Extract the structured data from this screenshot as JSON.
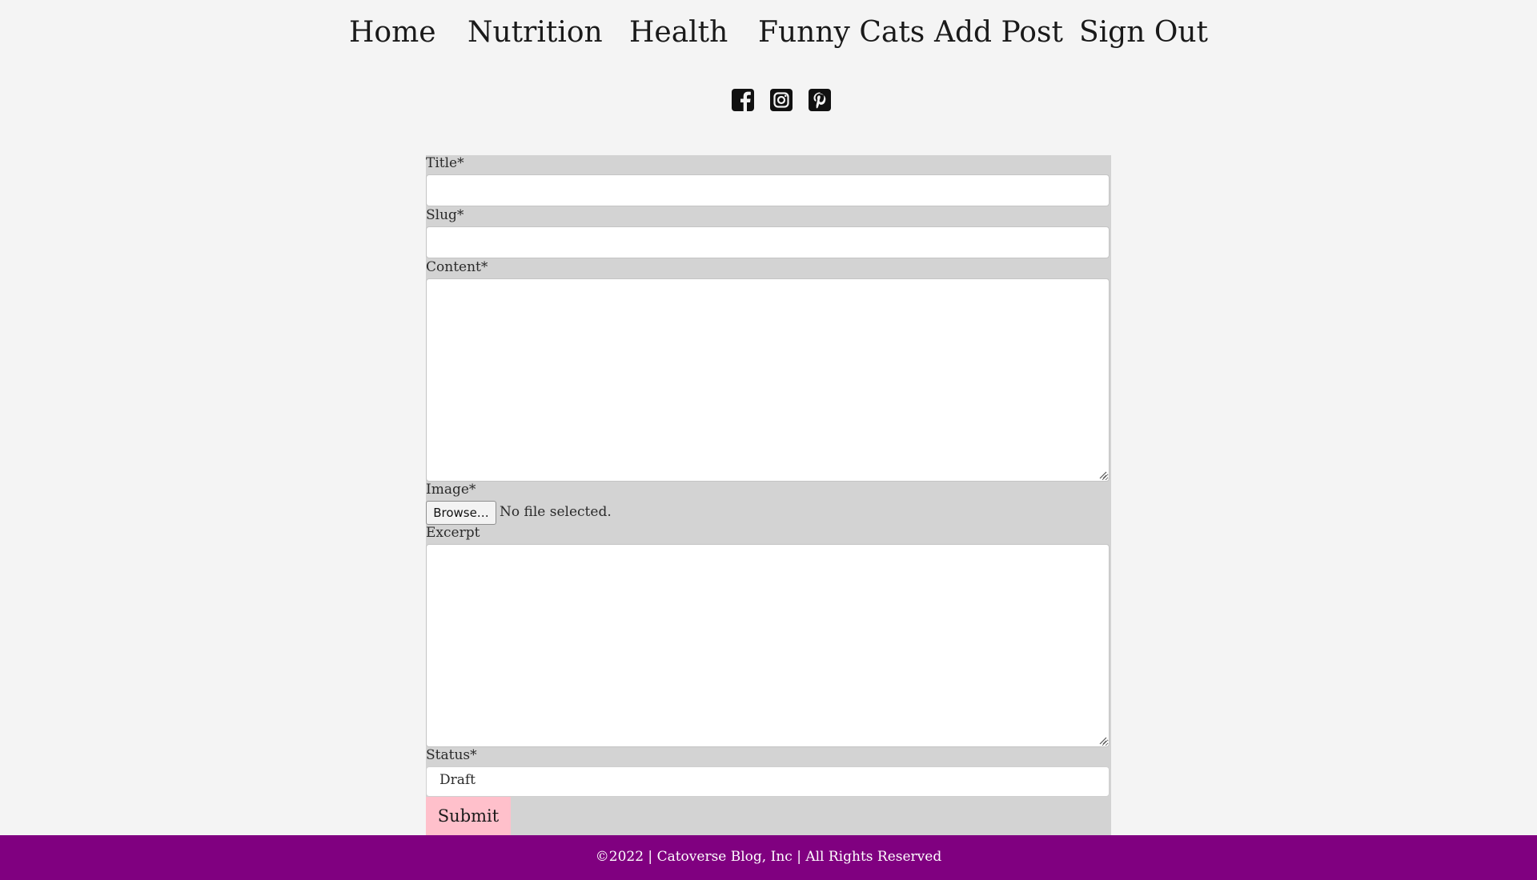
{
  "nav": {
    "items": [
      {
        "label": "Home"
      },
      {
        "label": "Nutrition"
      },
      {
        "label": "Health"
      },
      {
        "label": "Funny Cats"
      },
      {
        "label": "Add Post"
      },
      {
        "label": "Sign Out"
      }
    ]
  },
  "social": {
    "icons": [
      "facebook-icon",
      "instagram-icon",
      "pinterest-icon"
    ]
  },
  "form": {
    "title_label": "Title*",
    "title_value": "",
    "slug_label": "Slug*",
    "slug_value": "",
    "content_label": "Content*",
    "content_value": "",
    "image_label": "Image*",
    "browse_label": "Browse…",
    "no_file_text": "No file selected.",
    "excerpt_label": "Excerpt",
    "excerpt_value": "",
    "status_label": "Status*",
    "status_value": "Draft",
    "submit_label": "Submit"
  },
  "footer": {
    "text": "©2022 | Catoverse Blog, Inc | All Rights Reserved"
  },
  "colors": {
    "page_bg": "#f4f4f4",
    "form_bg": "#d3d3d3",
    "submit_bg": "#ffc0cb",
    "footer_bg": "#800080",
    "footer_text": "#ffffff"
  }
}
